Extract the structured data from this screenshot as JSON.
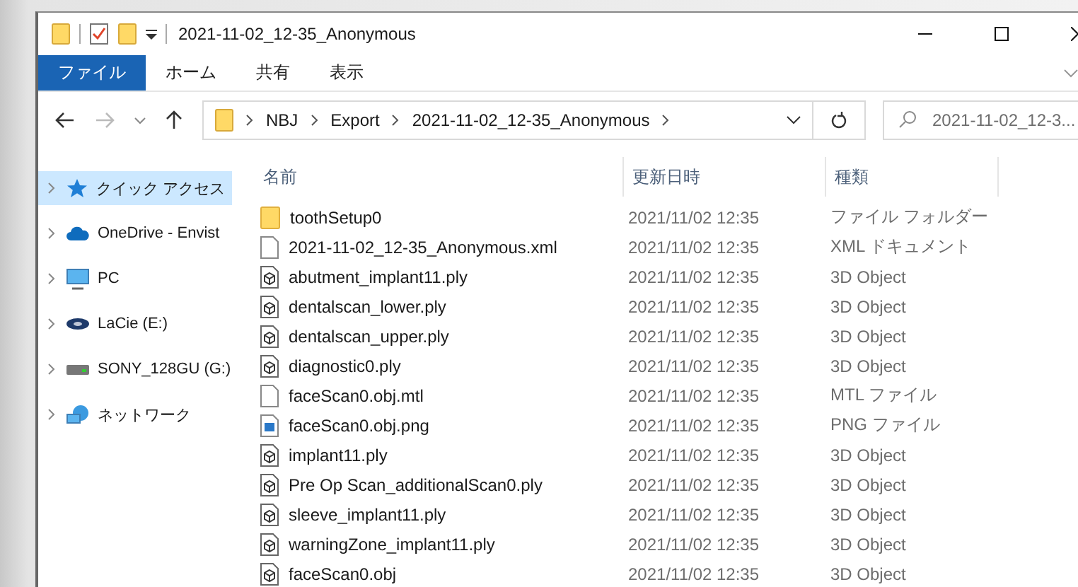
{
  "window": {
    "title": "2021-11-02_12-35_Anonymous"
  },
  "ribbon_tabs": [
    {
      "label": "ファイル",
      "selected": true
    },
    {
      "label": "ホーム",
      "selected": false
    },
    {
      "label": "共有",
      "selected": false
    },
    {
      "label": "表示",
      "selected": false
    }
  ],
  "address_bar": {
    "crumbs": [
      "NBJ",
      "Export",
      "2021-11-02_12-35_Anonymous"
    ]
  },
  "search": {
    "placeholder": "2021-11-02_12-3..."
  },
  "nav_pane": [
    {
      "label": "クイック アクセス",
      "kind": "star",
      "selected": true
    },
    {
      "label": "OneDrive - Envist",
      "kind": "cloud",
      "selected": false
    },
    {
      "label": "PC",
      "kind": "pc",
      "selected": false
    },
    {
      "label": "LaCie (E:)",
      "kind": "lacie",
      "selected": false
    },
    {
      "label": "SONY_128GU (G:)",
      "kind": "drive",
      "selected": false
    },
    {
      "label": "ネットワーク",
      "kind": "network",
      "selected": false
    }
  ],
  "table": {
    "columns": [
      "名前",
      "更新日時",
      "種類"
    ],
    "rows": [
      {
        "name": "toothSetup0",
        "date": "2021/11/02 12:35",
        "type": "ファイル フォルダー",
        "kind": "folder"
      },
      {
        "name": "2021-11-02_12-35_Anonymous.xml",
        "date": "2021/11/02 12:35",
        "type": "XML ドキュメント",
        "kind": "document"
      },
      {
        "name": "abutment_implant11.ply",
        "date": "2021/11/02 12:35",
        "type": "3D Object",
        "kind": "object"
      },
      {
        "name": "dentalscan_lower.ply",
        "date": "2021/11/02 12:35",
        "type": "3D Object",
        "kind": "object"
      },
      {
        "name": "dentalscan_upper.ply",
        "date": "2021/11/02 12:35",
        "type": "3D Object",
        "kind": "object"
      },
      {
        "name": "diagnostic0.ply",
        "date": "2021/11/02 12:35",
        "type": "3D Object",
        "kind": "object"
      },
      {
        "name": "faceScan0.obj.mtl",
        "date": "2021/11/02 12:35",
        "type": "MTL ファイル",
        "kind": "document"
      },
      {
        "name": "faceScan0.obj.png",
        "date": "2021/11/02 12:35",
        "type": "PNG ファイル",
        "kind": "image"
      },
      {
        "name": "implant11.ply",
        "date": "2021/11/02 12:35",
        "type": "3D Object",
        "kind": "object"
      },
      {
        "name": "Pre Op Scan_additionalScan0.ply",
        "date": "2021/11/02 12:35",
        "type": "3D Object",
        "kind": "object"
      },
      {
        "name": "sleeve_implant11.ply",
        "date": "2021/11/02 12:35",
        "type": "3D Object",
        "kind": "object"
      },
      {
        "name": "warningZone_implant11.ply",
        "date": "2021/11/02 12:35",
        "type": "3D Object",
        "kind": "object"
      },
      {
        "name": "faceScan0.obj",
        "date": "2021/11/02 12:35",
        "type": "3D Object",
        "kind": "object"
      }
    ]
  }
}
